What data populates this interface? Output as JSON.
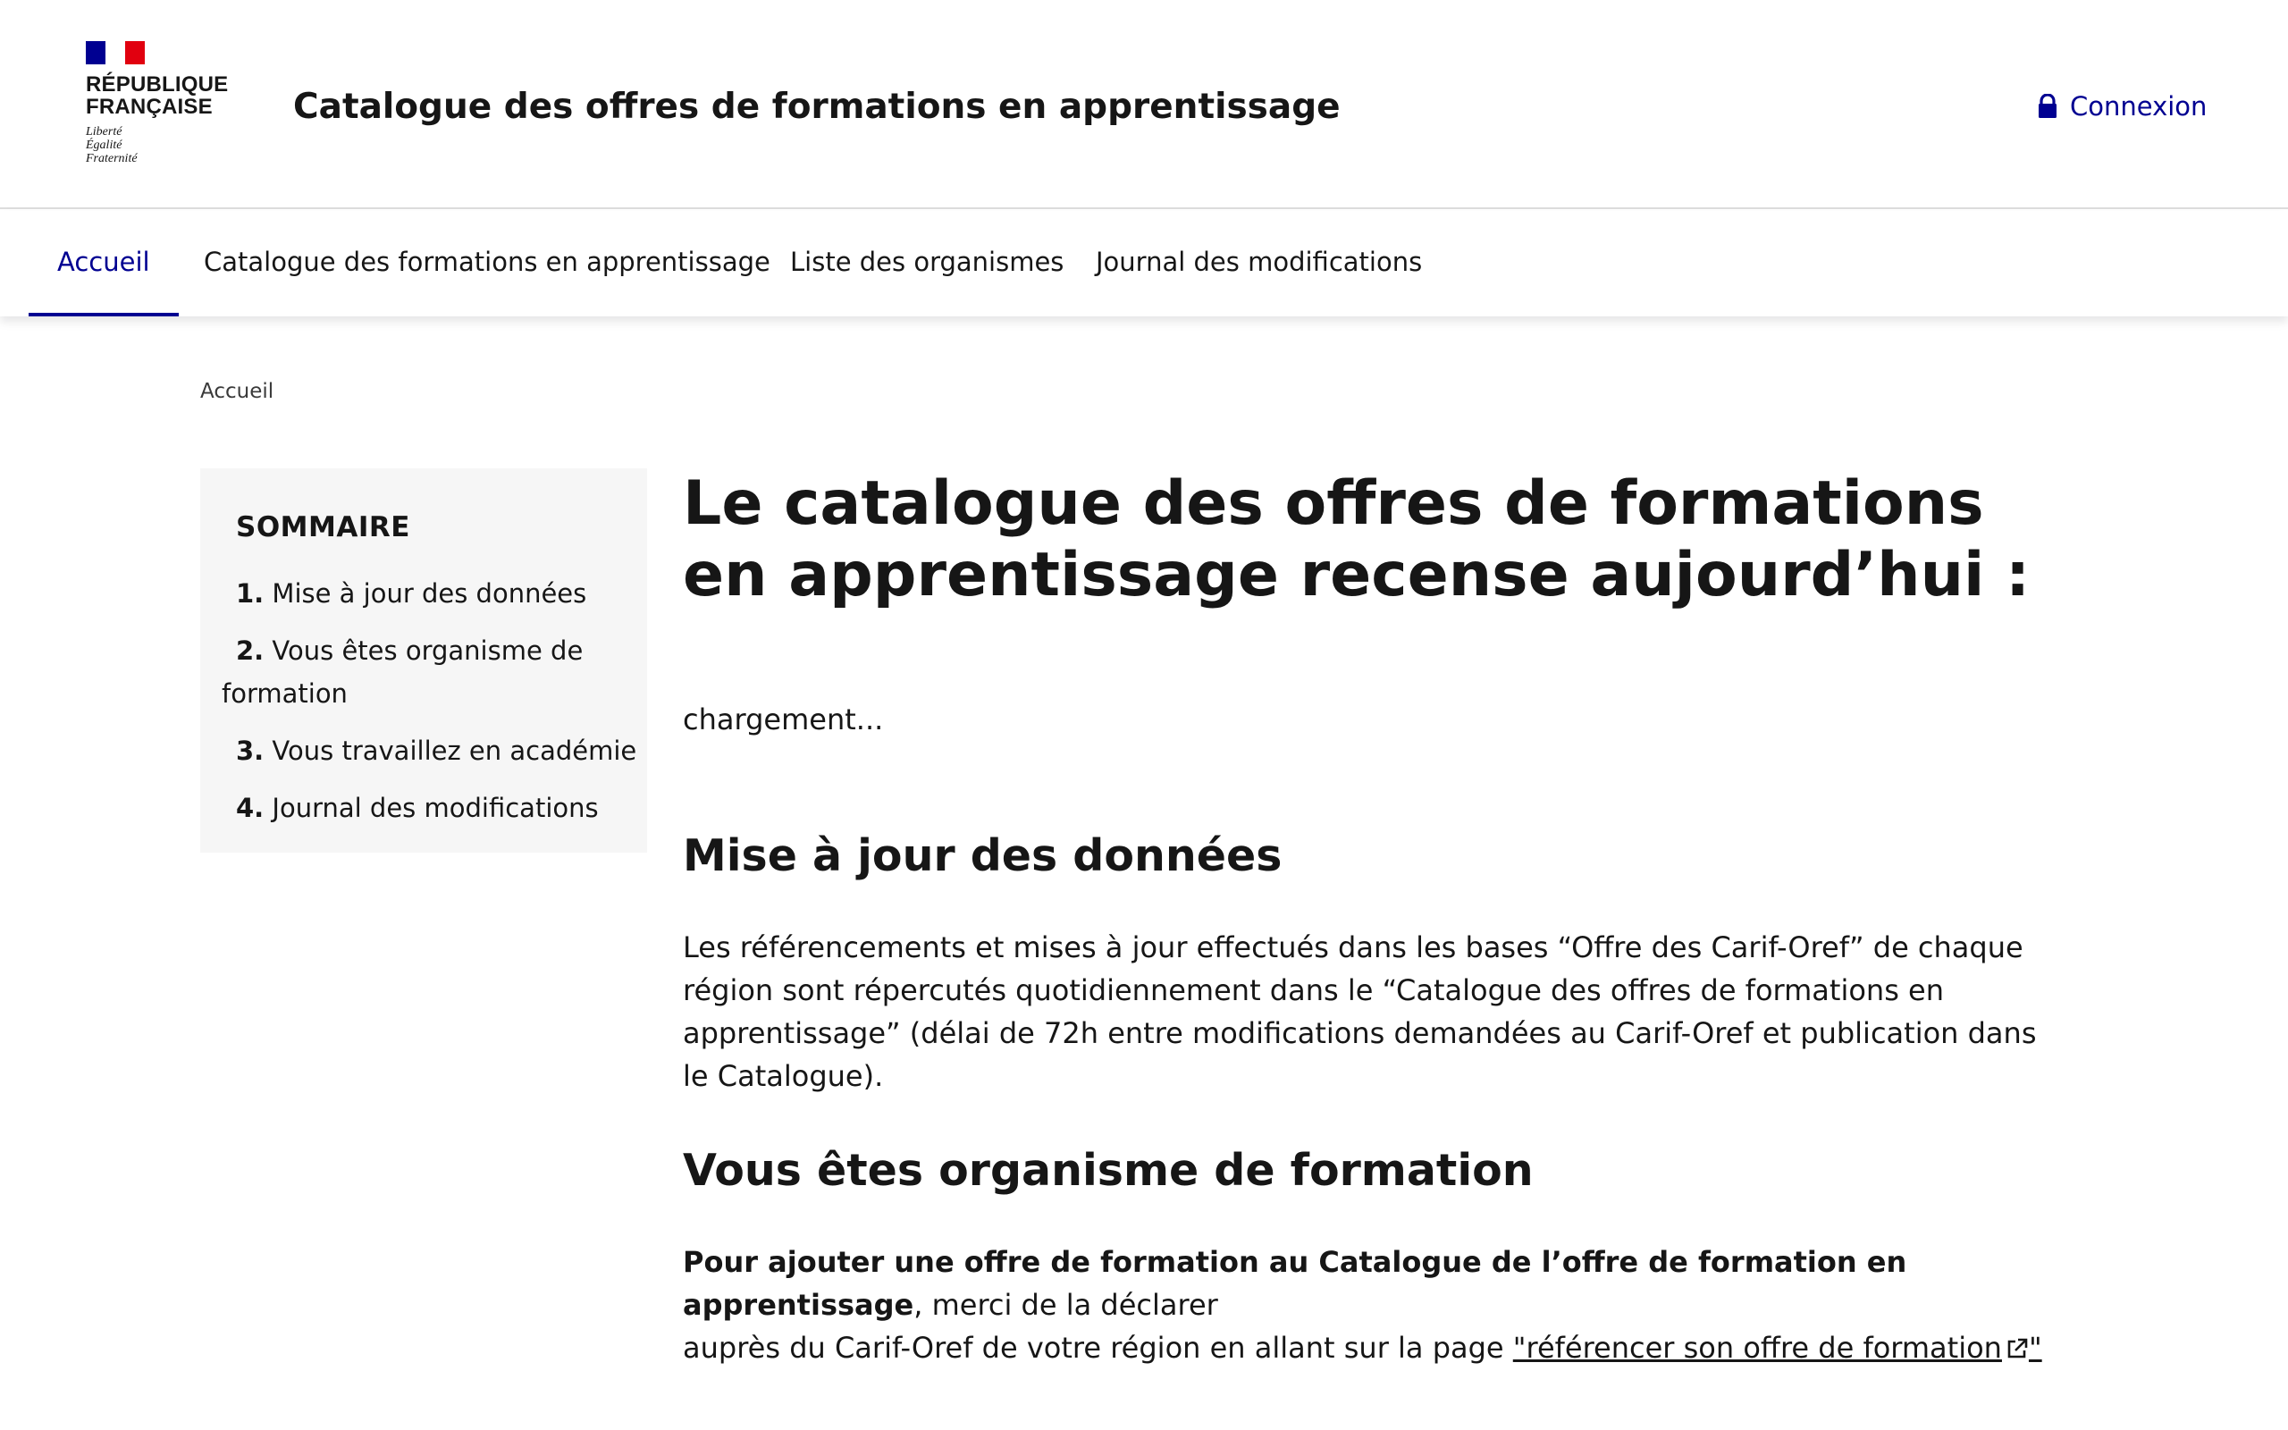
{
  "header": {
    "logo_line1": "RÉPUBLIQUE",
    "logo_line2": "FRANÇAISE",
    "devise": "Liberté\nÉgalité\nFraternité",
    "site_title": "Catalogue des offres de formations en apprentissage",
    "login_label": "Connexion",
    "login_icon": "lock-icon"
  },
  "nav": {
    "items": [
      {
        "label": "Accueil",
        "active": true
      },
      {
        "label": "Catalogue des formations en apprentissage",
        "active": false
      },
      {
        "label": "Liste des organismes",
        "active": false
      },
      {
        "label": "Journal des modifications",
        "active": false
      }
    ]
  },
  "breadcrumb": {
    "current": "Accueil"
  },
  "sommaire": {
    "title": "SOMMAIRE",
    "items": [
      {
        "num": "1.",
        "label": "Mise à jour des données"
      },
      {
        "num": "2.",
        "label": "Vous êtes organisme de formation"
      },
      {
        "num": "3.",
        "label": "Vous travaillez en académie"
      },
      {
        "num": "4.",
        "label": "Journal des modifications"
      }
    ]
  },
  "main": {
    "title": "Le catalogue des offres de formations en apprentissage recense aujourd’hui :",
    "loading": "chargement...",
    "section1": {
      "heading": "Mise à jour des données",
      "text": "Les référencements et mises à jour effectués dans les bases “Offre des Carif-Oref” de chaque région sont répercutés quotidiennement dans le “Catalogue des offres de formations en apprentissage” (délai de 72h entre modifications demandées au Carif-Oref et publication dans le Catalogue)."
    },
    "section2": {
      "heading": "Vous êtes organisme de formation",
      "bold_text": "Pour ajouter une offre de formation au Catalogue de l’offre de formation en apprentissage",
      "text_after_bold": ", merci de la déclarer",
      "text_line2": "auprès du Carif-Oref de votre région en allant sur la page ",
      "link_label": "\"référencer son offre de formation",
      "link_end": "\"",
      "link_icon": "external-link-icon"
    }
  }
}
